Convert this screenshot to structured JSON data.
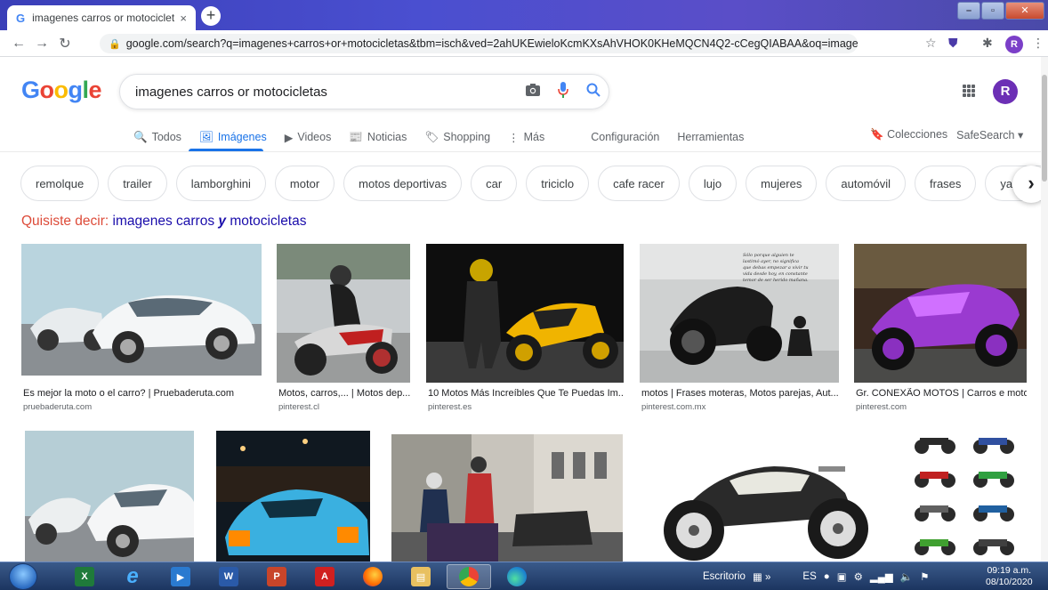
{
  "browser": {
    "tab_title": "imagenes carros or motocicletas",
    "tab_close": "×",
    "new_tab": "+",
    "url": "google.com/search?q=imagenes+carros+or+motocicletas&tbm=isch&ved=2ahUKEwieloKcmKXsAhVHOK0KHeMQCN4Q2-cCegQIABAA&oq=imagenes+carros+or+m...",
    "profile_initial": "R"
  },
  "google": {
    "query": "imagenes carros or motocicletas",
    "avatar_initial": "R",
    "menu": [
      {
        "icon": "🔍",
        "label": "Todos"
      },
      {
        "icon": "🖼",
        "label": "Imágenes"
      },
      {
        "icon": "▶",
        "label": "Videos"
      },
      {
        "icon": "📰",
        "label": "Noticias"
      },
      {
        "icon": "🏷",
        "label": "Shopping"
      },
      {
        "icon": "⋮",
        "label": "Más"
      }
    ],
    "tools": [
      "Configuración",
      "Herramientas"
    ],
    "collections": "Colecciones",
    "safesearch": "SafeSearch ▾",
    "chips": [
      "remolque",
      "trailer",
      "lamborghini",
      "motor",
      "motos deportivas",
      "car",
      "triciclo",
      "cafe racer",
      "lujo",
      "mujeres",
      "automóvil",
      "frases",
      "yamaha"
    ],
    "did_you_mean": {
      "prefix": "Quisiste decir:",
      "before": "imagenes carros",
      "emph": "y",
      "after": "motocicletas"
    }
  },
  "results_row1": [
    {
      "title": "Es mejor la moto o el carro? | Pruebaderuta.com",
      "source": "pruebaderuta.com"
    },
    {
      "title": "Motos, carros,... | Motos dep...",
      "source": "pinterest.cl"
    },
    {
      "title": "10 Motos Más Increíbles Que Te Puedas Im...",
      "source": "pinterest.es"
    },
    {
      "title": "motos | Frases moteras, Motos parejas, Aut...",
      "source": "pinterest.com.mx"
    },
    {
      "title": "Gr. CONEXÃO MOTOS | Carros e moto...",
      "source": "pinterest.com"
    }
  ],
  "taskbar": {
    "tray_label": "Escritorio",
    "lang": "ES",
    "time": "09:19 a.m.",
    "date": "08/10/2020"
  },
  "colors": {
    "link": "#1a0dab",
    "accent": "#1a73e8",
    "correction": "#dd4b39"
  }
}
